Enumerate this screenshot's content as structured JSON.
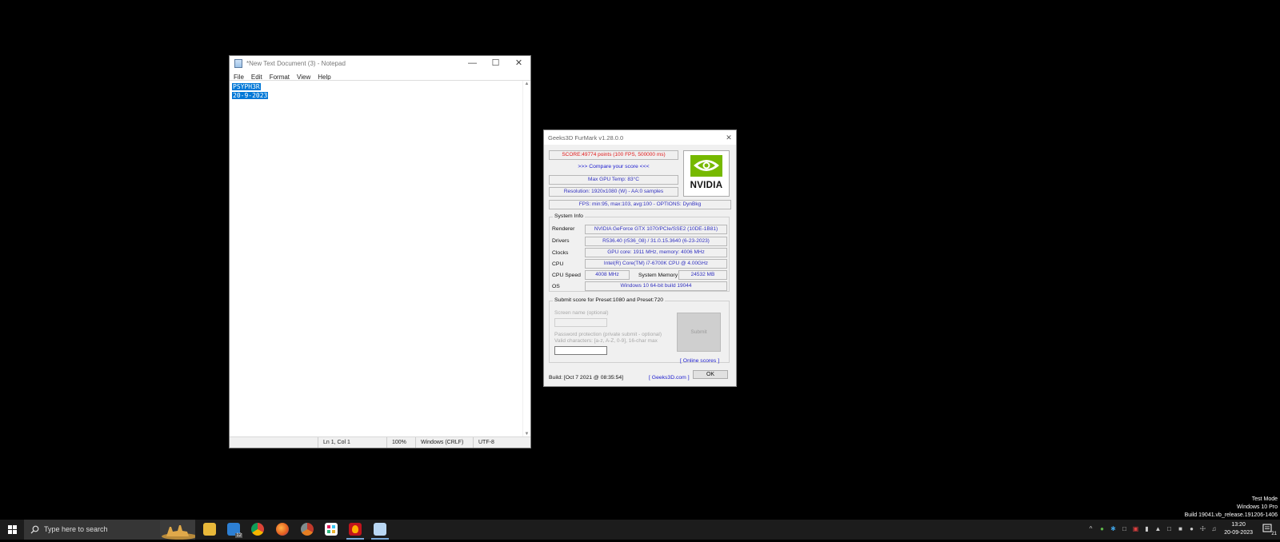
{
  "notepad": {
    "title": "*New Text Document (3) - Notepad",
    "menu": [
      "File",
      "Edit",
      "Format",
      "View",
      "Help"
    ],
    "lines": [
      "PSYPH3R",
      "20-9-2023"
    ],
    "status": {
      "position": "Ln 1, Col 1",
      "zoom": "100%",
      "line_ending": "Windows (CRLF)",
      "encoding": "UTF-8"
    }
  },
  "furmark": {
    "title": "Geeks3D FurMark v1.28.0.0",
    "score": "SCORE:49774 points (100 FPS, 500000 ms)",
    "compare": ">>> Compare your score <<<",
    "max_temp": "Max GPU Temp: 83°C",
    "resolution": "Resolution: 1920x1080 (W) - AA:0 samples",
    "fps": "FPS: min:95, max:103, avg:100 - OPTIONS: DynBkg",
    "logo_text": "NVIDIA",
    "system_info": {
      "group_label": "System Info",
      "renderer_label": "Renderer",
      "renderer": "NVIDIA GeForce GTX 1070/PCIe/SSE2 (10DE-1B81)",
      "drivers_label": "Drivers",
      "drivers": "R536.40 (r536_08) / 31.0.15.3640 (6-23-2023)",
      "clocks_label": "Clocks",
      "clocks": "GPU core: 1911 MHz, memory: 4006 MHz",
      "cpu_label": "CPU",
      "cpu": "Intel(R) Core(TM) i7-6700K CPU @ 4.00GHz",
      "cpu_speed_label": "CPU Speed",
      "cpu_speed": "4008 MHz",
      "memory_label": "System Memory",
      "memory": "24532 MB",
      "os_label": "OS",
      "os": "Windows 10 64-bit build 19044"
    },
    "submit": {
      "group_label": "Submit score for Preset:1080 and Preset:720",
      "screen_name_label": "Screen name (optional)",
      "password_label": "Password protection (private submit - optional)",
      "valid_chars": "Valid characters: [a-z, A-Z, 0-9], 16-char max",
      "submit_button": "Submit",
      "online_scores": "[ Online scores ]"
    },
    "build": "Build: [Oct  7 2021 @ 08:35:54]",
    "geeks3d_link": "[ Geeks3D.com ]",
    "ok_button": "OK"
  },
  "watermark": {
    "line1": "Test Mode",
    "line2": "Windows 10 Pro",
    "line3": "Build 19041.vb_release.191206-1406"
  },
  "taskbar": {
    "search_placeholder": "Type here to search",
    "mail_badge": "12",
    "time": "13:20",
    "date": "20-09-2023",
    "notification_count": "21"
  }
}
